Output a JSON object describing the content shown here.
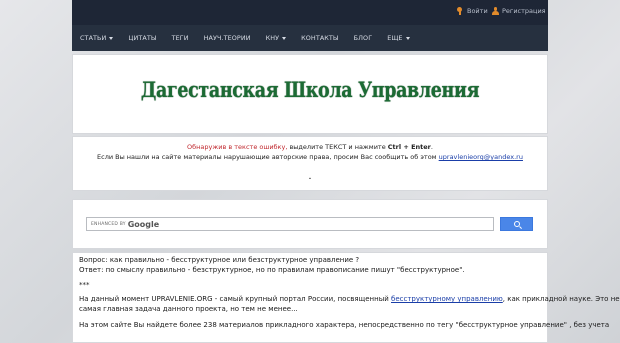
{
  "topbar": {
    "login": "Войти",
    "register": "Регистрация"
  },
  "nav": {
    "items": [
      {
        "label": "СТАТЬИ",
        "dropdown": true
      },
      {
        "label": "ЦИТАТЫ",
        "dropdown": false
      },
      {
        "label": "ТЕГИ",
        "dropdown": false
      },
      {
        "label": "НАУЧ.ТЕОРИИ",
        "dropdown": false
      },
      {
        "label": "КНУ",
        "dropdown": true
      },
      {
        "label": "КОНТАКТЫ",
        "dropdown": false
      },
      {
        "label": "БЛОГ",
        "dropdown": false
      },
      {
        "label": "ЕЩЕ",
        "dropdown": true
      }
    ]
  },
  "logo": {
    "text": "Дагестанская Школа Управления"
  },
  "notice": {
    "red_part": "Обнаружив в тексте ошибку,",
    "rest_part": " выделите ТЕКСТ и нажмите ",
    "keys": "Ctrl + Enter",
    "line1_end": ".",
    "line2": "Если Вы нашли на сайте материалы нарушающие авторские права, просим Вас сообщить об этом ",
    "email": "upravlenieorg@yandex.ru",
    "dot": "."
  },
  "search": {
    "enhanced_by": "ENHANCED BY",
    "brand": "Google"
  },
  "content": {
    "question": "Вопрос: как правильно - бесструктурное или безструктурное управление ?",
    "answer": "Ответ: по смыслу правильно - безструктурное, но по правилам правописание пишут \"бесструктурное\".",
    "stars": "***",
    "p1_a": "На данный момент UPRAVLENIE.ORG - самый крупный портал России, посвященный ",
    "p1_link": "бесструктурному управлению",
    "p1_b": ", как прикладной науке. Это не",
    "p1_c": "самая главная задача данного проекта, но тем не менее...",
    "p2": "На этом сайте Вы найдете более 238 материалов прикладного характера, непосредственно по тегу \"бесструктурное управление\" , без учета"
  }
}
